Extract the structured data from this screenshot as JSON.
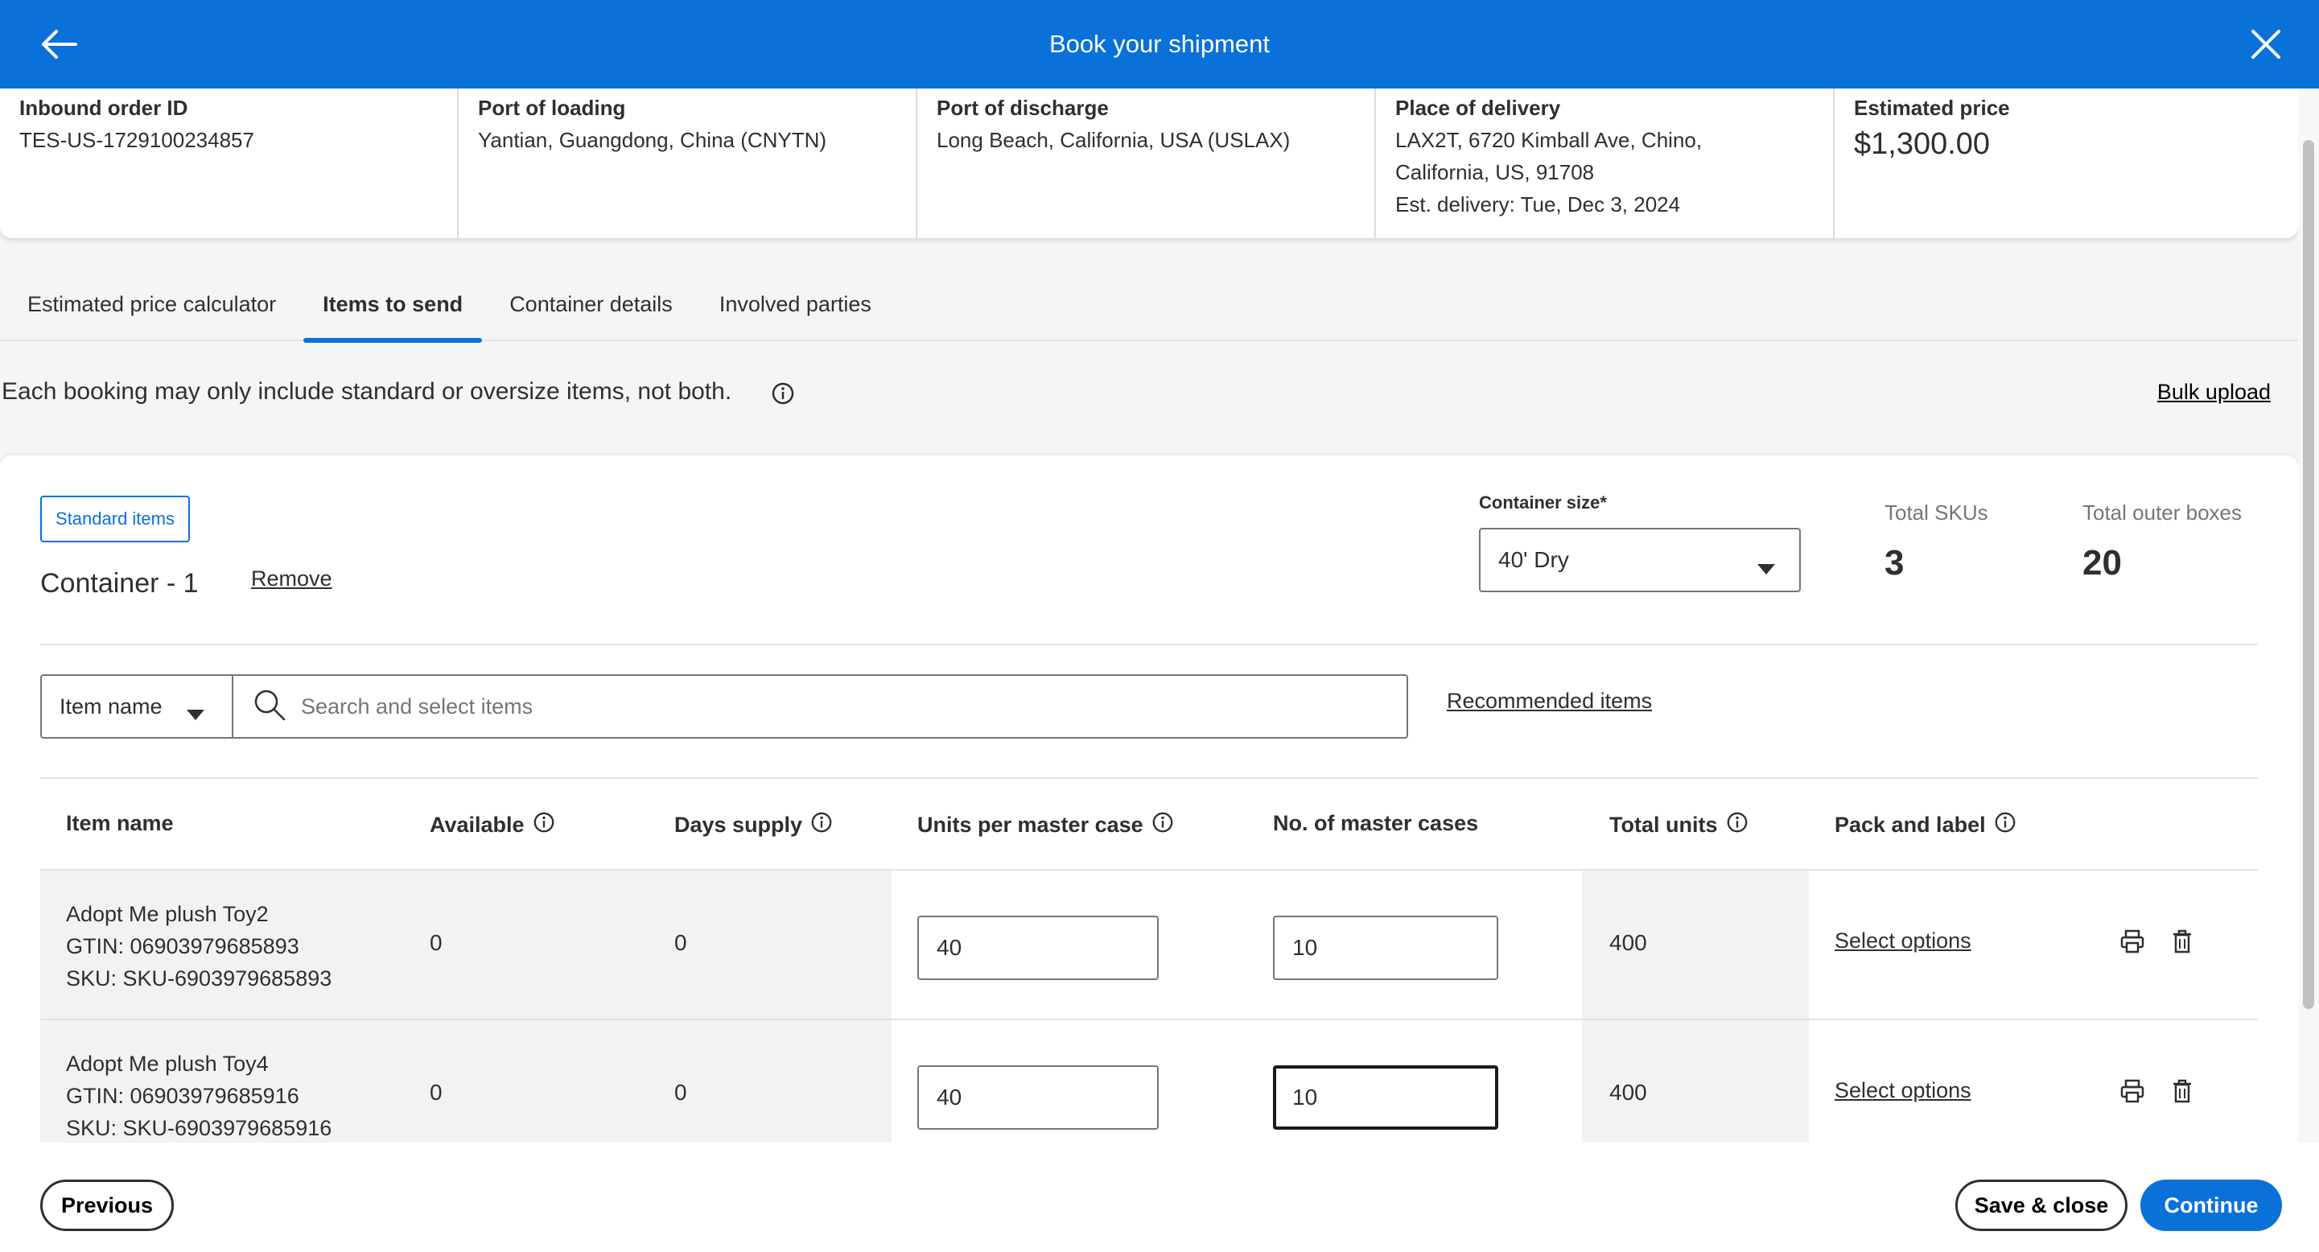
{
  "header": {
    "title": "Book your shipment",
    "back_icon": "arrow-left-icon",
    "close_icon": "close-icon",
    "bg_color": "#0a71d9"
  },
  "summary": {
    "inbound_order": {
      "label": "Inbound order ID",
      "value": "TES-US-1729100234857"
    },
    "port_loading": {
      "label": "Port of loading",
      "value": "Yantian, Guangdong, China (CNYTN)"
    },
    "port_discharge": {
      "label": "Port of discharge",
      "value": "Long Beach, California, USA (USLAX)"
    },
    "delivery": {
      "label": "Place of delivery",
      "line1": "LAX2T, 6720 Kimball Ave, Chino,",
      "line2": "California, US, 91708",
      "line3": "Est. delivery: Tue, Dec 3, 2024"
    },
    "price": {
      "label": "Estimated price",
      "value": "$1,300.00"
    }
  },
  "tabs": [
    {
      "label": "Estimated price calculator",
      "active": false
    },
    {
      "label": "Items to send",
      "active": true
    },
    {
      "label": "Container details",
      "active": false
    },
    {
      "label": "Involved parties",
      "active": false
    }
  ],
  "info": {
    "message": "Each booking may only include standard or oversize items, not both.",
    "bulk_upload": "Bulk upload"
  },
  "container": {
    "badge": "Standard items",
    "title": "Container - 1",
    "remove": "Remove",
    "size_label": "Container size*",
    "size_value": "40' Dry",
    "total_skus_label": "Total SKUs",
    "total_skus_value": "3",
    "total_boxes_label": "Total outer boxes",
    "total_boxes_value": "20"
  },
  "search": {
    "filter_value": "Item name",
    "placeholder": "Search and select items",
    "recommended": "Recommended items"
  },
  "table": {
    "columns": [
      "Item name",
      "Available",
      "Days supply",
      "Units per master case",
      "No. of master cases",
      "Total units",
      "Pack and label"
    ],
    "rows": [
      {
        "name": "Adopt Me plush Toy2",
        "gtin": "GTIN: 06903979685893",
        "sku": "SKU: SKU-6903979685893",
        "available": "0",
        "days_supply": "0",
        "units_per_case": "40",
        "master_cases": "10",
        "total_units": "400",
        "pack_label": "Select options"
      },
      {
        "name": "Adopt Me plush Toy4",
        "gtin": "GTIN: 06903979685916",
        "sku": "SKU: SKU-6903979685916",
        "available": "0",
        "days_supply": "0",
        "units_per_case": "40",
        "master_cases": "10",
        "total_units": "400",
        "pack_label": "Select options"
      }
    ]
  },
  "footer": {
    "previous": "Previous",
    "save_close": "Save & close",
    "continue": "Continue"
  }
}
